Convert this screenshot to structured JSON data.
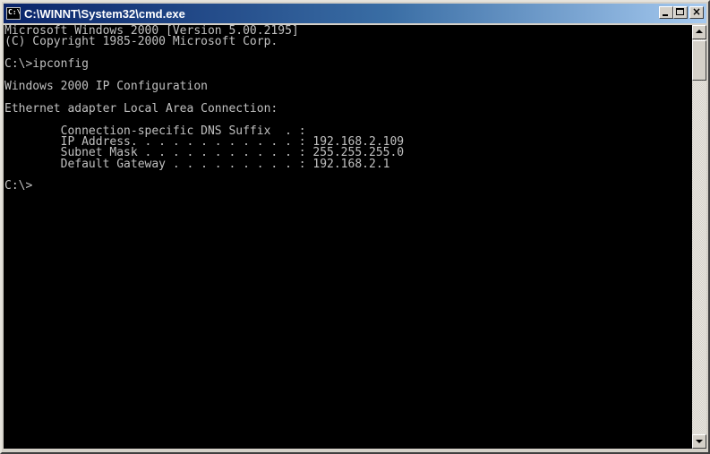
{
  "window": {
    "title": "C:\\WINNT\\System32\\cmd.exe",
    "icon_name": "cmd-icon",
    "icon_text": "C:\\"
  },
  "controls": {
    "minimize_icon": "minimize-icon",
    "maximize_icon": "maximize-icon",
    "close_icon": "close-icon",
    "close_glyph": "×"
  },
  "console": {
    "lines": [
      "Microsoft Windows 2000 [Version 5.00.2195]",
      "(C) Copyright 1985-2000 Microsoft Corp.",
      "",
      "C:\\>ipconfig",
      "",
      "Windows 2000 IP Configuration",
      "",
      "Ethernet adapter Local Area Connection:",
      "",
      "        Connection-specific DNS Suffix  . :",
      "        IP Address. . . . . . . . . . . . : 192.168.2.109",
      "        Subnet Mask . . . . . . . . . . . : 255.255.255.0",
      "        Default Gateway . . . . . . . . . : 192.168.2.1",
      "",
      "C:\\>"
    ]
  },
  "scrollbar": {
    "up_icon": "scroll-up-arrow-icon",
    "down_icon": "scroll-down-arrow-icon"
  },
  "colors": {
    "console_bg": "#000000",
    "console_fg": "#c0c0c0",
    "titlebar_start": "#0a246a",
    "titlebar_end": "#a6caf0"
  }
}
